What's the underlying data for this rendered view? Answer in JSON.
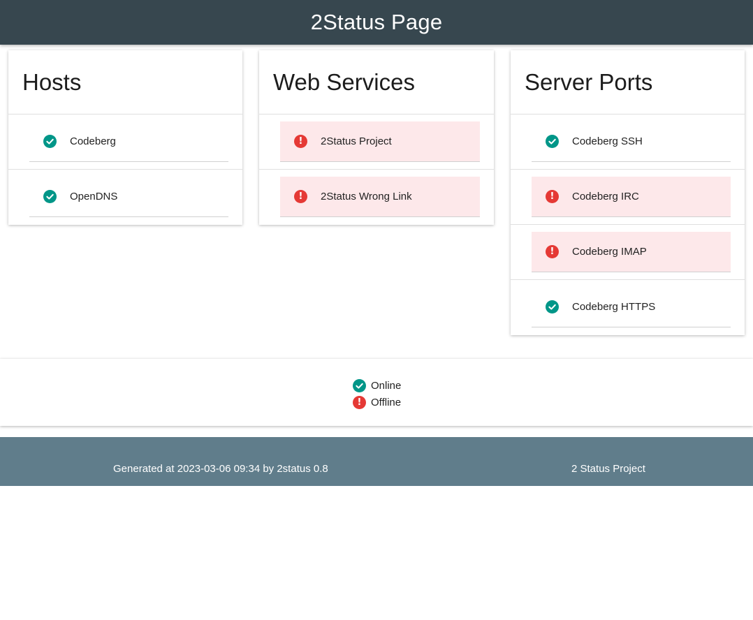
{
  "header": {
    "title": "2Status Page"
  },
  "panels": {
    "hosts": {
      "title": "Hosts",
      "items": [
        {
          "label": "Codeberg",
          "status": "online"
        },
        {
          "label": "OpenDNS",
          "status": "online"
        }
      ]
    },
    "web_services": {
      "title": "Web Services",
      "items": [
        {
          "label": "2Status Project",
          "status": "offline"
        },
        {
          "label": "2Status Wrong Link",
          "status": "offline"
        }
      ]
    },
    "server_ports": {
      "title": "Server Ports",
      "items": [
        {
          "label": "Codeberg SSH",
          "status": "online"
        },
        {
          "label": "Codeberg IRC",
          "status": "offline"
        },
        {
          "label": "Codeberg IMAP",
          "status": "offline"
        },
        {
          "label": "Codeberg HTTPS",
          "status": "online"
        }
      ]
    }
  },
  "legend": {
    "online_label": "Online",
    "offline_label": "Offline"
  },
  "footer": {
    "generated": "Generated at 2023-03-06 09:34 by 2status 0.8",
    "project_link": "2 Status Project"
  },
  "colors": {
    "header_bg": "#37474f",
    "footer_bg": "#607d8b",
    "online": "#009688",
    "offline": "#e53935",
    "offline_row_bg": "#fde8ea"
  },
  "icons": {
    "online": "check-circle-icon",
    "offline": "alert-circle-icon"
  }
}
